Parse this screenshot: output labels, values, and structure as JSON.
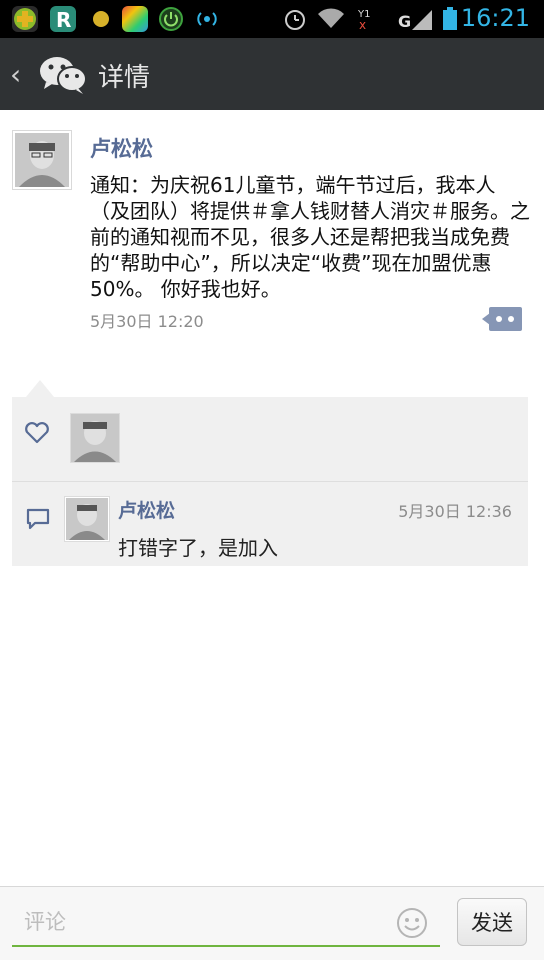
{
  "status_bar": {
    "time": "16:21",
    "network": "G"
  },
  "header": {
    "back_icon": "chevron-left-icon",
    "logo": "wechat-logo",
    "title": "详情"
  },
  "post": {
    "author": "卢松松",
    "text": "通知：为庆祝61儿童节，端午节过后，我本人（及团队）将提供＃拿人钱财替人消灾＃服务。之前的通知视而不见，很多人还是帮把我当成免费的“帮助中心”，所以决定“收费”现在加盟优惠50%。 你好我也好。",
    "time": "5月30日 12:20"
  },
  "comments": [
    {
      "author": "卢松松",
      "time": "5月30日 12:36",
      "text": "打错字了，是加入"
    }
  ],
  "input": {
    "placeholder": "评论",
    "send_label": "发送"
  },
  "colors": {
    "name": "#576b95",
    "accent": "#6fb53f",
    "header": "#2f3234"
  }
}
